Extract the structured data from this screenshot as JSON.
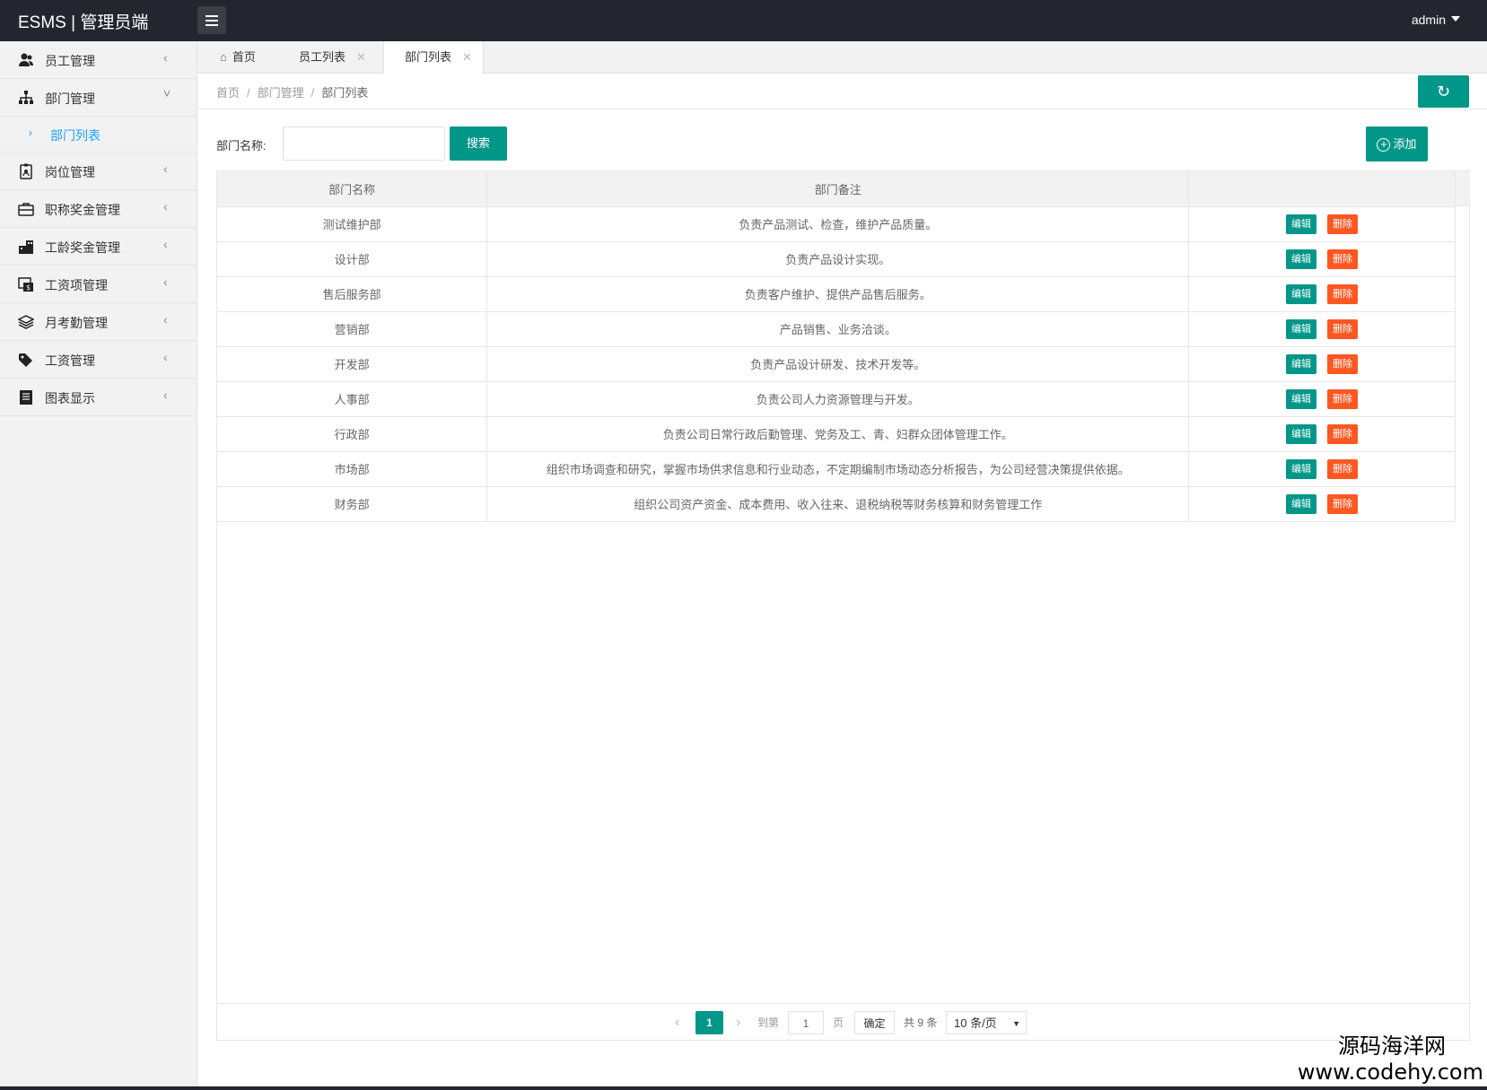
{
  "header": {
    "logo": "ESMS | 管理员端",
    "user": "admin"
  },
  "sidebar": {
    "items": [
      {
        "label": "员工管理",
        "icon": "users-icon"
      },
      {
        "label": "部门管理",
        "icon": "sitemap-icon",
        "children": [
          {
            "label": "部门列表"
          }
        ]
      },
      {
        "label": "岗位管理",
        "icon": "badge-icon"
      },
      {
        "label": "职称奖金管理",
        "icon": "briefcase-icon"
      },
      {
        "label": "工龄奖金管理",
        "icon": "building-icon"
      },
      {
        "label": "工资项管理",
        "icon": "money-icon"
      },
      {
        "label": "月考勤管理",
        "icon": "layers-icon"
      },
      {
        "label": "工资管理",
        "icon": "tag-icon"
      },
      {
        "label": "图表显示",
        "icon": "document-icon"
      }
    ]
  },
  "tabs": [
    {
      "label": "首页"
    },
    {
      "label": "员工列表"
    },
    {
      "label": "部门列表",
      "active": true
    }
  ],
  "breadcrumb": {
    "home": "首页",
    "section": "部门管理",
    "current": "部门列表"
  },
  "search": {
    "label": "部门名称:",
    "value": "",
    "button": "搜索",
    "add_button": "添加"
  },
  "table": {
    "headers": [
      "部门名称",
      "部门备注",
      ""
    ],
    "edit_label": "编辑",
    "delete_label": "删除",
    "rows": [
      {
        "name": "测试维护部",
        "note": "负责产品测试、检查，维护产品质量。"
      },
      {
        "name": "设计部",
        "note": "负责产品设计实现。"
      },
      {
        "name": "售后服务部",
        "note": "负责客户维护、提供产品售后服务。"
      },
      {
        "name": "营销部",
        "note": "产品销售、业务洽谈。"
      },
      {
        "name": "开发部",
        "note": "负责产品设计研发、技术开发等。"
      },
      {
        "name": "人事部",
        "note": "负责公司人力资源管理与开发。"
      },
      {
        "name": "行政部",
        "note": "负责公司日常行政后勤管理、党务及工、青、妇群众团体管理工作。"
      },
      {
        "name": "市场部",
        "note": "组织市场调查和研究，掌握市场供求信息和行业动态，不定期编制市场动态分析报告，为公司经营决策提供依据。"
      },
      {
        "name": "财务部",
        "note": "组织公司资产资金、成本费用、收入往来、退税纳税等财务核算和财务管理工作"
      }
    ]
  },
  "pager": {
    "current": "1",
    "goto_label": "到第",
    "goto_value": "1",
    "page_label": "页",
    "ok_label": "确定",
    "total": "共 9 条",
    "page_size": "10 条/页"
  },
  "watermark": {
    "line1": "源码海洋网",
    "line2": "www.codehy.com"
  },
  "colors": {
    "primary": "#009688",
    "danger": "#ff5722",
    "topbar": "#23262e",
    "link": "#1e9fff"
  }
}
